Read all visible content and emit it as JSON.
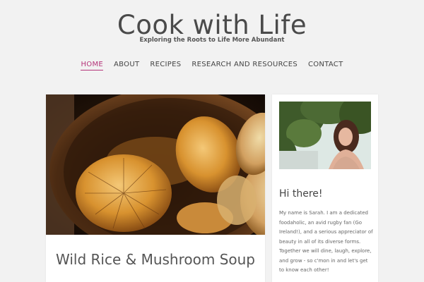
{
  "site": {
    "title": "Cook with Life",
    "tagline": "Exploring the Roots to Life More Abundant"
  },
  "nav": {
    "items": [
      "HOME",
      "ABOUT",
      "RECIPES",
      "RESEARCH AND RESOURCES",
      "CONTACT"
    ],
    "active": "HOME"
  },
  "post": {
    "title": "Wild Rice & Mushroom Soup"
  },
  "sidebar": {
    "widget_title": "Hi there!",
    "widget_text": "My name is Sarah. I am a dedicated foodaholic, an avid rugby fan (Go Ireland!), and a serious appreciator of beauty in all of its diverse forms. Together we will dine, laugh, explore, and grow - so c'mon in and let's get to know each other!"
  },
  "colors": {
    "accent": "#b5357a",
    "background": "#f2f2f2"
  }
}
